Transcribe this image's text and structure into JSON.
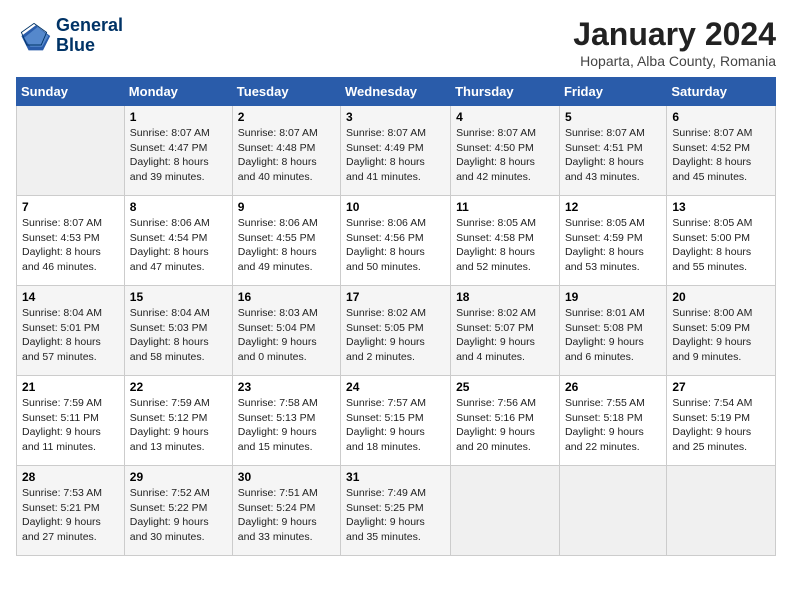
{
  "logo": {
    "line1": "General",
    "line2": "Blue"
  },
  "title": "January 2024",
  "subtitle": "Hoparta, Alba County, Romania",
  "days_of_week": [
    "Sunday",
    "Monday",
    "Tuesday",
    "Wednesday",
    "Thursday",
    "Friday",
    "Saturday"
  ],
  "weeks": [
    [
      {
        "day": "",
        "sunrise": "",
        "sunset": "",
        "daylight": ""
      },
      {
        "day": "1",
        "sunrise": "Sunrise: 8:07 AM",
        "sunset": "Sunset: 4:47 PM",
        "daylight": "Daylight: 8 hours and 39 minutes."
      },
      {
        "day": "2",
        "sunrise": "Sunrise: 8:07 AM",
        "sunset": "Sunset: 4:48 PM",
        "daylight": "Daylight: 8 hours and 40 minutes."
      },
      {
        "day": "3",
        "sunrise": "Sunrise: 8:07 AM",
        "sunset": "Sunset: 4:49 PM",
        "daylight": "Daylight: 8 hours and 41 minutes."
      },
      {
        "day": "4",
        "sunrise": "Sunrise: 8:07 AM",
        "sunset": "Sunset: 4:50 PM",
        "daylight": "Daylight: 8 hours and 42 minutes."
      },
      {
        "day": "5",
        "sunrise": "Sunrise: 8:07 AM",
        "sunset": "Sunset: 4:51 PM",
        "daylight": "Daylight: 8 hours and 43 minutes."
      },
      {
        "day": "6",
        "sunrise": "Sunrise: 8:07 AM",
        "sunset": "Sunset: 4:52 PM",
        "daylight": "Daylight: 8 hours and 45 minutes."
      }
    ],
    [
      {
        "day": "7",
        "sunrise": "Sunrise: 8:07 AM",
        "sunset": "Sunset: 4:53 PM",
        "daylight": "Daylight: 8 hours and 46 minutes."
      },
      {
        "day": "8",
        "sunrise": "Sunrise: 8:06 AM",
        "sunset": "Sunset: 4:54 PM",
        "daylight": "Daylight: 8 hours and 47 minutes."
      },
      {
        "day": "9",
        "sunrise": "Sunrise: 8:06 AM",
        "sunset": "Sunset: 4:55 PM",
        "daylight": "Daylight: 8 hours and 49 minutes."
      },
      {
        "day": "10",
        "sunrise": "Sunrise: 8:06 AM",
        "sunset": "Sunset: 4:56 PM",
        "daylight": "Daylight: 8 hours and 50 minutes."
      },
      {
        "day": "11",
        "sunrise": "Sunrise: 8:05 AM",
        "sunset": "Sunset: 4:58 PM",
        "daylight": "Daylight: 8 hours and 52 minutes."
      },
      {
        "day": "12",
        "sunrise": "Sunrise: 8:05 AM",
        "sunset": "Sunset: 4:59 PM",
        "daylight": "Daylight: 8 hours and 53 minutes."
      },
      {
        "day": "13",
        "sunrise": "Sunrise: 8:05 AM",
        "sunset": "Sunset: 5:00 PM",
        "daylight": "Daylight: 8 hours and 55 minutes."
      }
    ],
    [
      {
        "day": "14",
        "sunrise": "Sunrise: 8:04 AM",
        "sunset": "Sunset: 5:01 PM",
        "daylight": "Daylight: 8 hours and 57 minutes."
      },
      {
        "day": "15",
        "sunrise": "Sunrise: 8:04 AM",
        "sunset": "Sunset: 5:03 PM",
        "daylight": "Daylight: 8 hours and 58 minutes."
      },
      {
        "day": "16",
        "sunrise": "Sunrise: 8:03 AM",
        "sunset": "Sunset: 5:04 PM",
        "daylight": "Daylight: 9 hours and 0 minutes."
      },
      {
        "day": "17",
        "sunrise": "Sunrise: 8:02 AM",
        "sunset": "Sunset: 5:05 PM",
        "daylight": "Daylight: 9 hours and 2 minutes."
      },
      {
        "day": "18",
        "sunrise": "Sunrise: 8:02 AM",
        "sunset": "Sunset: 5:07 PM",
        "daylight": "Daylight: 9 hours and 4 minutes."
      },
      {
        "day": "19",
        "sunrise": "Sunrise: 8:01 AM",
        "sunset": "Sunset: 5:08 PM",
        "daylight": "Daylight: 9 hours and 6 minutes."
      },
      {
        "day": "20",
        "sunrise": "Sunrise: 8:00 AM",
        "sunset": "Sunset: 5:09 PM",
        "daylight": "Daylight: 9 hours and 9 minutes."
      }
    ],
    [
      {
        "day": "21",
        "sunrise": "Sunrise: 7:59 AM",
        "sunset": "Sunset: 5:11 PM",
        "daylight": "Daylight: 9 hours and 11 minutes."
      },
      {
        "day": "22",
        "sunrise": "Sunrise: 7:59 AM",
        "sunset": "Sunset: 5:12 PM",
        "daylight": "Daylight: 9 hours and 13 minutes."
      },
      {
        "day": "23",
        "sunrise": "Sunrise: 7:58 AM",
        "sunset": "Sunset: 5:13 PM",
        "daylight": "Daylight: 9 hours and 15 minutes."
      },
      {
        "day": "24",
        "sunrise": "Sunrise: 7:57 AM",
        "sunset": "Sunset: 5:15 PM",
        "daylight": "Daylight: 9 hours and 18 minutes."
      },
      {
        "day": "25",
        "sunrise": "Sunrise: 7:56 AM",
        "sunset": "Sunset: 5:16 PM",
        "daylight": "Daylight: 9 hours and 20 minutes."
      },
      {
        "day": "26",
        "sunrise": "Sunrise: 7:55 AM",
        "sunset": "Sunset: 5:18 PM",
        "daylight": "Daylight: 9 hours and 22 minutes."
      },
      {
        "day": "27",
        "sunrise": "Sunrise: 7:54 AM",
        "sunset": "Sunset: 5:19 PM",
        "daylight": "Daylight: 9 hours and 25 minutes."
      }
    ],
    [
      {
        "day": "28",
        "sunrise": "Sunrise: 7:53 AM",
        "sunset": "Sunset: 5:21 PM",
        "daylight": "Daylight: 9 hours and 27 minutes."
      },
      {
        "day": "29",
        "sunrise": "Sunrise: 7:52 AM",
        "sunset": "Sunset: 5:22 PM",
        "daylight": "Daylight: 9 hours and 30 minutes."
      },
      {
        "day": "30",
        "sunrise": "Sunrise: 7:51 AM",
        "sunset": "Sunset: 5:24 PM",
        "daylight": "Daylight: 9 hours and 33 minutes."
      },
      {
        "day": "31",
        "sunrise": "Sunrise: 7:49 AM",
        "sunset": "Sunset: 5:25 PM",
        "daylight": "Daylight: 9 hours and 35 minutes."
      },
      {
        "day": "",
        "sunrise": "",
        "sunset": "",
        "daylight": ""
      },
      {
        "day": "",
        "sunrise": "",
        "sunset": "",
        "daylight": ""
      },
      {
        "day": "",
        "sunrise": "",
        "sunset": "",
        "daylight": ""
      }
    ]
  ]
}
